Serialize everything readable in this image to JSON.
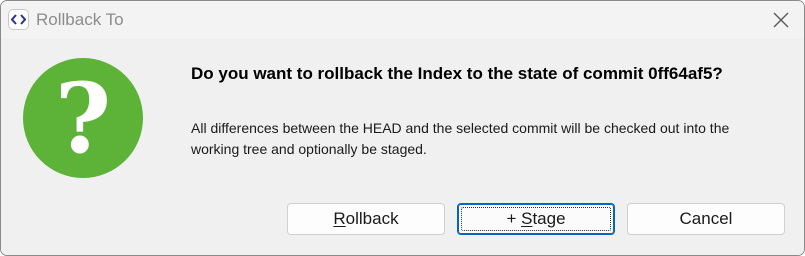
{
  "window": {
    "title": "Rollback To",
    "close_icon": "close-icon",
    "app_icon": "code-brackets-icon"
  },
  "dialog": {
    "icon": "question-icon",
    "icon_color": "#5cb338",
    "question_glyph": "?",
    "headline": "Do you want to rollback the Index to the state of commit 0ff64af5?",
    "message": "All differences between the HEAD and the selected commit will be checked out into the working tree and optionally be staged."
  },
  "buttons": {
    "rollback": {
      "mnemonic": "R",
      "rest": "ollback"
    },
    "stage": {
      "prefix": "+ ",
      "mnemonic": "S",
      "rest": "tage"
    },
    "cancel": {
      "label": "Cancel"
    }
  },
  "colors": {
    "accent": "#0067c0",
    "background": "#f0f0f0"
  }
}
